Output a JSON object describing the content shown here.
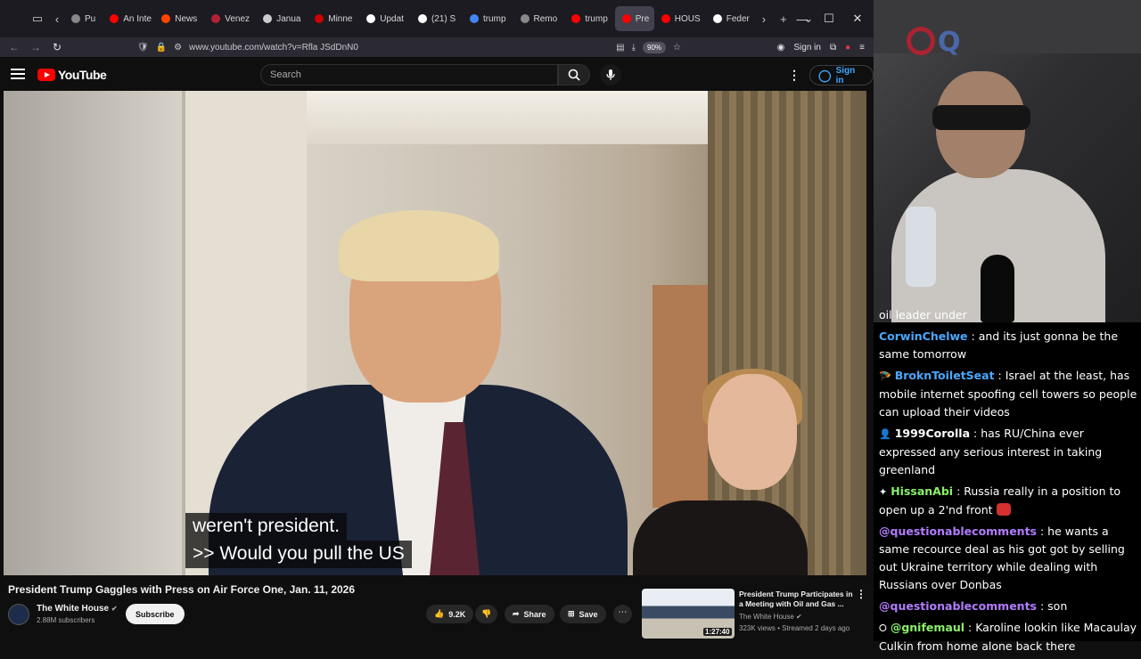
{
  "browser": {
    "tabs": [
      {
        "label": "Pu",
        "color": "#888888"
      },
      {
        "label": "An Inte",
        "color": "#ff0000"
      },
      {
        "label": "News",
        "color": "#ff4500"
      },
      {
        "label": "Venez",
        "color": "#b22234"
      },
      {
        "label": "Janua",
        "color": "#cccccc"
      },
      {
        "label": "Minne",
        "color": "#cc0000"
      },
      {
        "label": "Updat",
        "color": "#ffffff"
      },
      {
        "label": "(21) S",
        "color": "#ffffff"
      },
      {
        "label": "trump",
        "color": "#4285f4"
      },
      {
        "label": "Remo",
        "color": "#888888"
      },
      {
        "label": "trump",
        "color": "#ff0000"
      },
      {
        "label": "Pre",
        "color": "#ff0000"
      },
      {
        "label": "HOUS",
        "color": "#ff0000"
      },
      {
        "label": "Feder",
        "color": "#ffffff"
      }
    ],
    "active_tab_index": 11,
    "url": "www.youtube.com/watch?v=Rfla JSdDnN0",
    "zoom": "90%",
    "sign_in_label": "Sign in"
  },
  "youtube": {
    "logo_text": "YouTube",
    "search_placeholder": "Search",
    "sign_in_label": "Sign in",
    "captions": [
      "weren't president.",
      ">> Would you pull the US"
    ],
    "video_title": "President Trump Gaggles with Press on Air Force One, Jan. 11, 2026",
    "channel_name": "The White House",
    "channel_subs": "2.88M subscribers",
    "subscribe_label": "Subscribe",
    "likes": "9.2K",
    "share_label": "Share",
    "save_label": "Save",
    "recommended": {
      "title": "President Trump Participates in a Meeting with Oil and Gas ...",
      "channel": "The White House",
      "meta": "323K views • Streamed 2 days ago",
      "duration": "1:27:40"
    }
  },
  "stream": {
    "chat": [
      {
        "badge": "",
        "user": "",
        "text": "oil leader under",
        "user_color": "#ffffff"
      },
      {
        "badge": "",
        "user": "CorwinChelwe",
        "text": "and its just gonna be the same tomorrow",
        "user_color": "#4aa8ff"
      },
      {
        "badge": "🪂",
        "user": "BroknToiletSeat",
        "text": "Israel at the least, has mobile internet spoofing cell towers so people can upload their videos",
        "user_color": "#4aa8ff"
      },
      {
        "badge": "👤",
        "user": "1999Corolla",
        "text": "has RU/China ever expressed any serious interest in taking greenland",
        "user_color": "#ffffff"
      },
      {
        "badge": "✦",
        "user": "HissanAbi",
        "text": "Russia really in a position to open up a 2'nd front",
        "user_color": "#8bef6a"
      },
      {
        "badge": "",
        "user": "@questionablecomments",
        "text": "he wants a same recource deal as his got got by selling out Ukraine territory while dealing with Russians over Donbas",
        "user_color": "#b27cff"
      },
      {
        "badge": "",
        "user": "@questionablecomments",
        "text": "son",
        "user_color": "#b27cff"
      },
      {
        "badge": "⭘",
        "user": "@gnifemaul",
        "text": "Karoline lookin like Macaulay Culkin from home alone back there",
        "user_color": "#8bef6a"
      }
    ]
  }
}
